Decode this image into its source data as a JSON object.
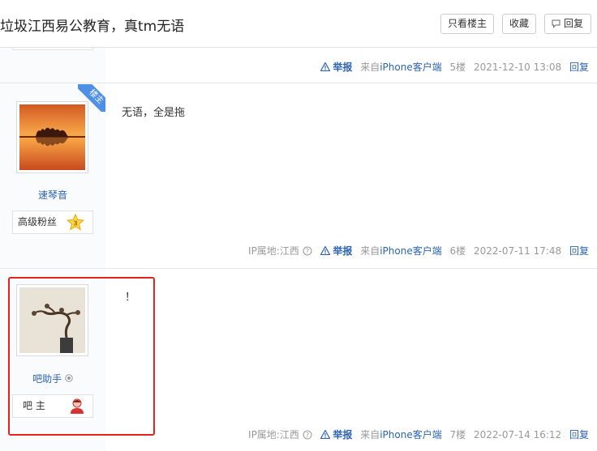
{
  "header": {
    "title": "垃圾江西易公教育，真tm无语",
    "only_op_label": "只看楼主",
    "favorite_label": "收藏",
    "reply_label": "回复"
  },
  "posts": [
    {
      "tail": {
        "report": "举报",
        "client_prefix": "来自",
        "client": "iPhone客户端",
        "floor": "5楼",
        "time": "2021-12-10 13:08",
        "reply": "回复"
      }
    },
    {
      "is_op": true,
      "op_label": "楼主",
      "username": "速琴音",
      "badge_label": "高级粉丝",
      "badge_level": "3",
      "content": "无语，全是拖",
      "tail": {
        "ip": "IP属地:江西",
        "report": "举报",
        "client_prefix": "来自",
        "client": "iPhone客户端",
        "floor": "6楼",
        "time": "2022-07-11 17:48",
        "reply": "回复"
      }
    },
    {
      "username": "吧助手",
      "badge_label": "吧 主",
      "content": "！",
      "tail": {
        "ip": "IP属地:江西",
        "report": "举报",
        "client_prefix": "来自",
        "client": "iPhone客户端",
        "floor": "7楼",
        "time": "2022-07-14 16:12",
        "reply": "回复"
      }
    }
  ]
}
